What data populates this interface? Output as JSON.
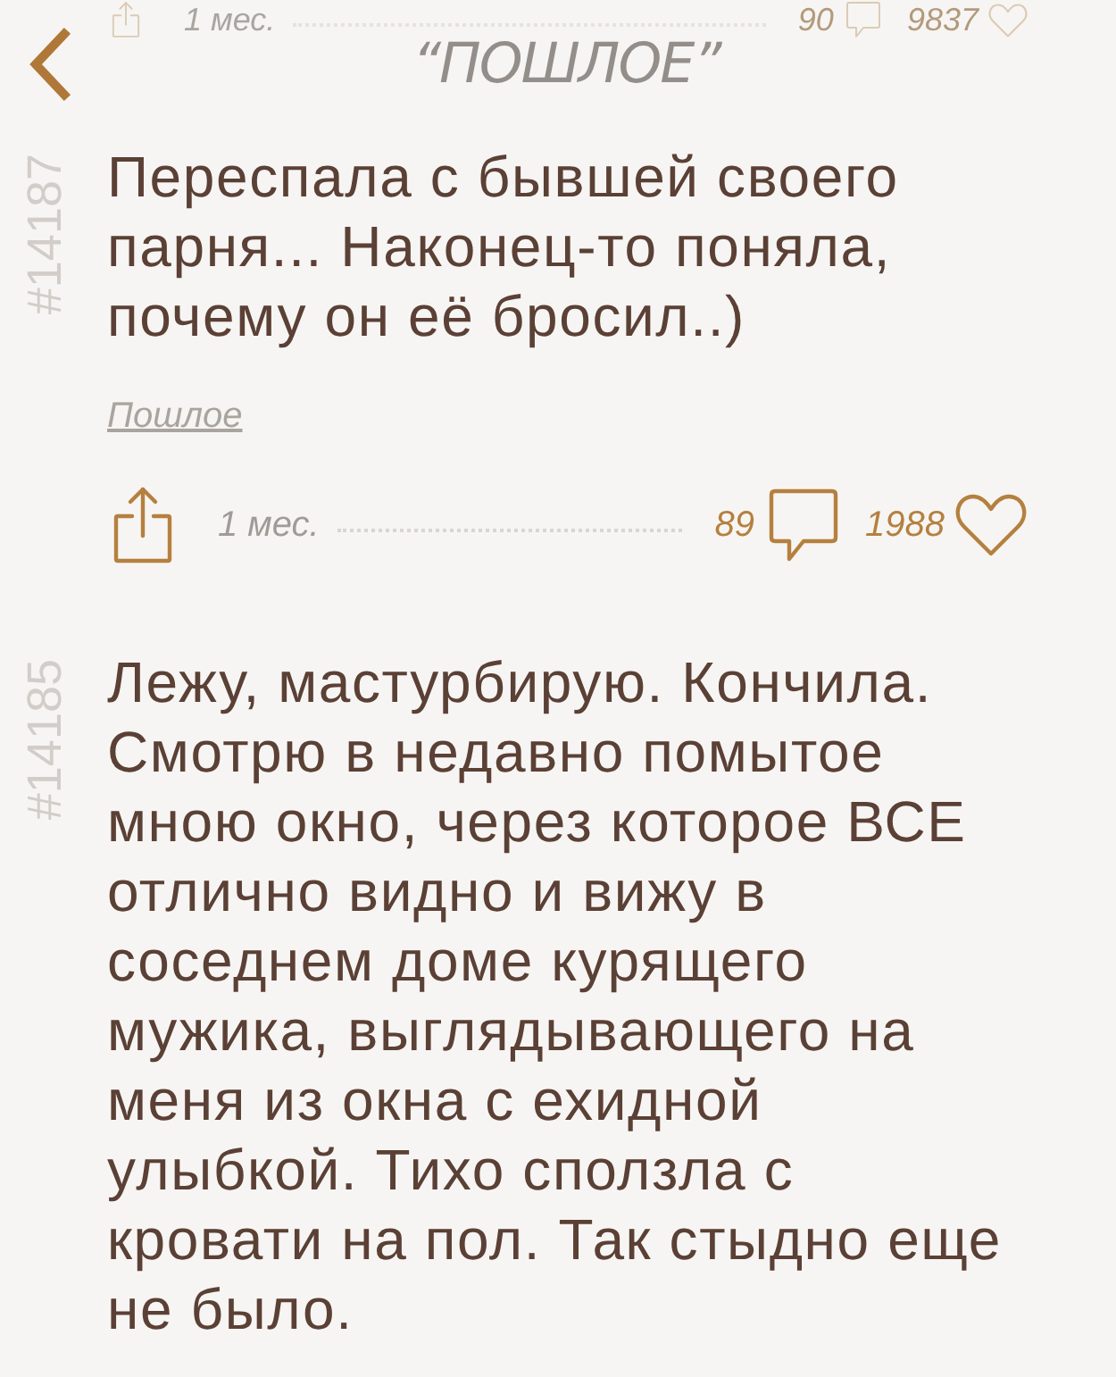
{
  "previous_post_actions": {
    "time": "1 мес.",
    "comments": "90",
    "likes": "9837"
  },
  "nav": {
    "title": "“ПОШЛОЕ”"
  },
  "posts": [
    {
      "number": "#14187",
      "text": "Переспала с бывшей своего парня... Наконец-то поняла, почему он её бросил..)",
      "tag": "Пошлое",
      "actions": {
        "time": "1 мес.",
        "comments": "89",
        "likes": "1988"
      }
    },
    {
      "number": "#14185",
      "text": "Лежу, мастурбирую. Кончила. Смотрю в недавно помытое мною окно, через которое ВСЕ отлично видно и вижу в соседнем доме курящего мужика, выглядывающего на меня из окна с ехидной улыбкой. Тихо сползла с кровати на пол. Так стыдно еще не было."
    }
  ]
}
